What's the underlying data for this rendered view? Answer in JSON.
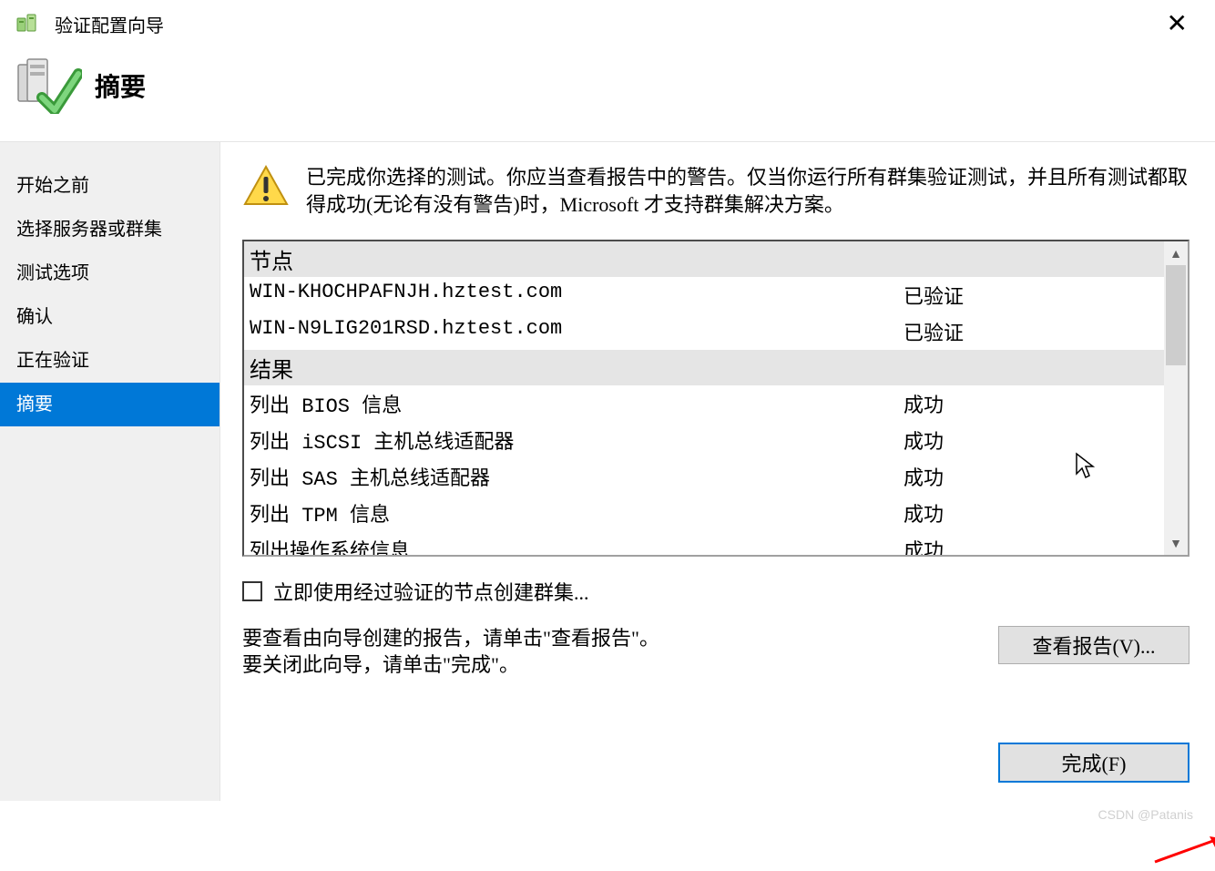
{
  "window": {
    "title": "验证配置向导"
  },
  "header": {
    "heading": "摘要"
  },
  "sidebar": {
    "items": [
      {
        "label": "开始之前",
        "active": false
      },
      {
        "label": "选择服务器或群集",
        "active": false
      },
      {
        "label": "测试选项",
        "active": false
      },
      {
        "label": "确认",
        "active": false
      },
      {
        "label": "正在验证",
        "active": false
      },
      {
        "label": "摘要",
        "active": true
      }
    ]
  },
  "main": {
    "message": "已完成你选择的测试。你应当查看报告中的警告。仅当你运行所有群集验证测试，并且所有测试都取得成功(无论有没有警告)时，Microsoft 才支持群集解决方案。",
    "groups": [
      {
        "title": "节点",
        "rows": [
          {
            "name": "WIN-KHOCHPAFNJH.hztest.com",
            "status": "已验证"
          },
          {
            "name": "WIN-N9LIG201RSD.hztest.com",
            "status": "已验证"
          }
        ]
      },
      {
        "title": "结果",
        "rows": [
          {
            "name": "列出 BIOS 信息",
            "status": "成功"
          },
          {
            "name": "列出 iSCSI 主机总线适配器",
            "status": "成功"
          },
          {
            "name": "列出 SAS 主机总线适配器",
            "status": "成功"
          },
          {
            "name": "列出 TPM 信息",
            "status": "成功"
          },
          {
            "name": "列出操作系统信息",
            "status": "成功"
          }
        ]
      }
    ],
    "checkbox_label": "立即使用经过验证的节点创建群集...",
    "hint_line1": "要查看由向导创建的报告，请单击\"查看报告\"。",
    "hint_line2": "要关闭此向导，请单击\"完成\"。",
    "view_report_label": "查看报告(V)...",
    "finish_label": "完成(F)"
  },
  "watermark": "CSDN @Patanis"
}
